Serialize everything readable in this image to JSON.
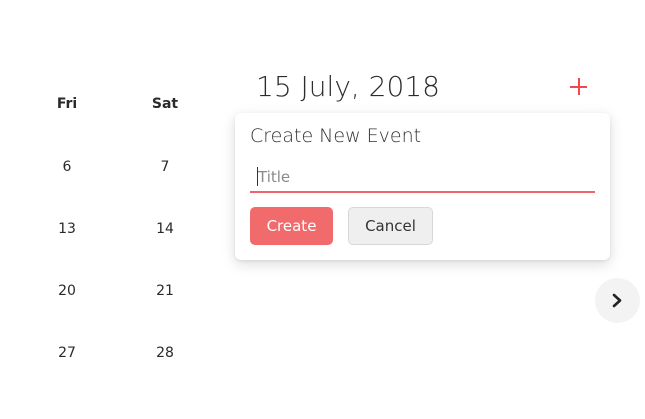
{
  "calendar": {
    "columns": [
      {
        "header": "Fri",
        "days": [
          "6",
          "13",
          "20",
          "27"
        ]
      },
      {
        "header": "Sat",
        "days": [
          "7",
          "14",
          "21",
          "28"
        ]
      }
    ]
  },
  "header": {
    "date_title": "15 July, 2018",
    "add_icon": "plus-icon",
    "accent_color": "#f0484e"
  },
  "event_popover": {
    "title": "Create New Event",
    "title_input": {
      "value": "",
      "placeholder": "Title"
    },
    "create_label": "Create",
    "cancel_label": "Cancel",
    "create_color": "#f26b6c"
  },
  "navigation": {
    "next_icon": "chevron-right-icon"
  }
}
